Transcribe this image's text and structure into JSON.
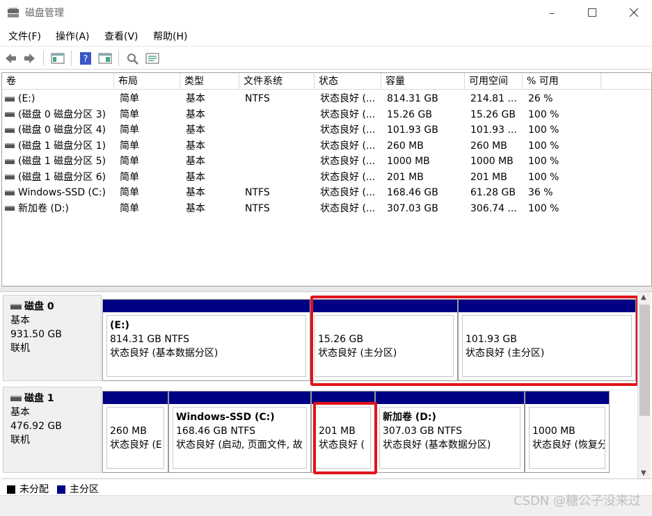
{
  "window": {
    "title": "磁盘管理",
    "icon": "disk-manager-icon",
    "controls": [
      "minimize-icon",
      "maximize-icon",
      "close-icon"
    ]
  },
  "menu": [
    "文件(F)",
    "操作(A)",
    "查看(V)",
    "帮助(H)"
  ],
  "toolbar": [
    "back-arrow-icon",
    "forward-arrow-icon",
    "console-tree-icon",
    "help-icon",
    "show-hide-pane-icon",
    "rescan-icon",
    "properties-icon"
  ],
  "columns": [
    "卷",
    "布局",
    "类型",
    "文件系统",
    "状态",
    "容量",
    "可用空间",
    "% 可用"
  ],
  "volumes": [
    [
      "(E:)",
      "简单",
      "基本",
      "NTFS",
      "状态良好 (...",
      "814.31 GB",
      "214.81 ...",
      "26 %"
    ],
    [
      "(磁盘 0 磁盘分区 3)",
      "简单",
      "基本",
      "",
      "状态良好 (...",
      "15.26 GB",
      "15.26 GB",
      "100 %"
    ],
    [
      "(磁盘 0 磁盘分区 4)",
      "简单",
      "基本",
      "",
      "状态良好 (...",
      "101.93 GB",
      "101.93 ...",
      "100 %"
    ],
    [
      "(磁盘 1 磁盘分区 1)",
      "简单",
      "基本",
      "",
      "状态良好 (...",
      "260 MB",
      "260 MB",
      "100 %"
    ],
    [
      "(磁盘 1 磁盘分区 5)",
      "简单",
      "基本",
      "",
      "状态良好 (...",
      "1000 MB",
      "1000 MB",
      "100 %"
    ],
    [
      "(磁盘 1 磁盘分区 6)",
      "简单",
      "基本",
      "",
      "状态良好 (...",
      "201 MB",
      "201 MB",
      "100 %"
    ],
    [
      "Windows-SSD (C:)",
      "简单",
      "基本",
      "NTFS",
      "状态良好 (...",
      "168.46 GB",
      "61.28 GB",
      "36 %"
    ],
    [
      "新加卷 (D:)",
      "简单",
      "基本",
      "NTFS",
      "状态良好 (...",
      "307.03 GB",
      "306.74 ...",
      "100 %"
    ]
  ],
  "disks": [
    {
      "name": "磁盘 0",
      "type": "基本",
      "size": "931.50 GB",
      "status": "联机",
      "partitions": [
        {
          "title": "(E:)",
          "size": "814.31 GB NTFS",
          "status": "状态良好 (基本数据分区)"
        },
        {
          "title": "",
          "size": "15.26 GB",
          "status": "状态良好 (主分区)"
        },
        {
          "title": "",
          "size": "101.93 GB",
          "status": "状态良好 (主分区)"
        }
      ]
    },
    {
      "name": "磁盘 1",
      "type": "基本",
      "size": "476.92 GB",
      "status": "联机",
      "partitions": [
        {
          "title": "",
          "size": "260 MB",
          "status": "状态良好 (E"
        },
        {
          "title": "Windows-SSD  (C:)",
          "size": "168.46 GB NTFS",
          "status": "状态良好 (启动, 页面文件, 故"
        },
        {
          "title": "",
          "size": "201 MB",
          "status": "状态良好 ("
        },
        {
          "title": "新加卷  (D:)",
          "size": "307.03 GB NTFS",
          "status": "状态良好 (基本数据分区)"
        },
        {
          "title": "",
          "size": "1000 MB",
          "status": "状态良好 (恢复分"
        }
      ]
    }
  ],
  "legend": [
    {
      "label": "未分配",
      "color": "#000000"
    },
    {
      "label": "主分区",
      "color": "#000084"
    }
  ],
  "watermark": "CSDN @糖公子没来过",
  "colors": {
    "partition_bar": "#000084",
    "highlight": "#e0141a"
  }
}
